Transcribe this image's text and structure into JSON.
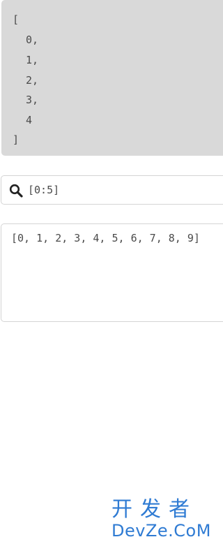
{
  "result": {
    "lines": [
      "[",
      "0,",
      "1,",
      "2,",
      "3,",
      "4",
      "]"
    ]
  },
  "query": {
    "value": "[0:5]",
    "icon": "search-icon"
  },
  "source": {
    "text": "[0, 1, 2, 3, 4, 5, 6, 7, 8, 9]"
  },
  "watermark": {
    "line1": "开发者",
    "line2": "DevZe.CoM"
  },
  "colors": {
    "result_background": "#d9d9d9",
    "text": "#4a4a4a",
    "border": "#d4d4d4",
    "watermark": "#2f7bd3"
  }
}
